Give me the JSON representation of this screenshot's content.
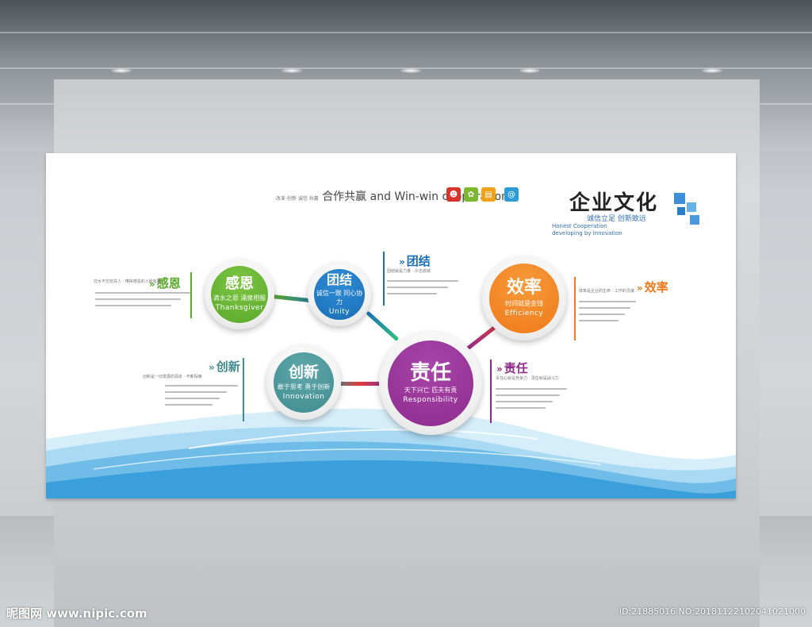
{
  "headline": {
    "main": "合作共赢 and Win-win cooperation",
    "tag": "改革·创新·诚信·共赢"
  },
  "brand": {
    "title": "企业文化",
    "slogan": "诚信立足 创新致远",
    "en1": "Honest Cooperation",
    "en2": "developing by innovation"
  },
  "values": [
    {
      "key": "gan-en",
      "title": "感恩",
      "sub": "滴水之恩 涌泉相报",
      "en": "Thanksgiver",
      "label": "感恩",
      "color": "#5aa82c"
    },
    {
      "key": "tuan-jie",
      "title": "团结",
      "sub": "诚信一致 同心协力",
      "en": "Unity",
      "label": "团结",
      "color": "#1a6fb5"
    },
    {
      "key": "xiao-lv",
      "title": "效率",
      "sub": "时间就是金钱",
      "en": "Efficiency",
      "label": "效率",
      "color": "#ef7a1a"
    },
    {
      "key": "chuang-xin",
      "title": "创新",
      "sub": "敢于思考 勇于创新",
      "en": "Innovation",
      "label": "创新",
      "color": "#3f8c8f"
    },
    {
      "key": "ze-ren",
      "title": "责任",
      "sub": "天下兴亡 匹夫有责",
      "en": "Responsibility",
      "label": "责任",
      "color": "#8e2b8f"
    }
  ],
  "blurbs": {
    "gan_en": "饮水不忘挖井人 · 懂得感恩的人最有福",
    "tuan_jie": "团结就是力量 · 众志成城",
    "xiao_lv": "效率是企业的生命 · 工作的灵魂",
    "chuang_xin": "创新是一切发展的源泉 · 不断探索",
    "ze_ren": "责任心就是竞争力 · 责任就是战斗力"
  },
  "watermark": {
    "left": "昵图网 www.nipic.com",
    "right": "ID:21885016 NO:20181122102041021000"
  },
  "colors": {
    "wave_light": "#bfe3f6",
    "wave_mid": "#7fc4ea",
    "wave_dark": "#3aa0dc"
  }
}
